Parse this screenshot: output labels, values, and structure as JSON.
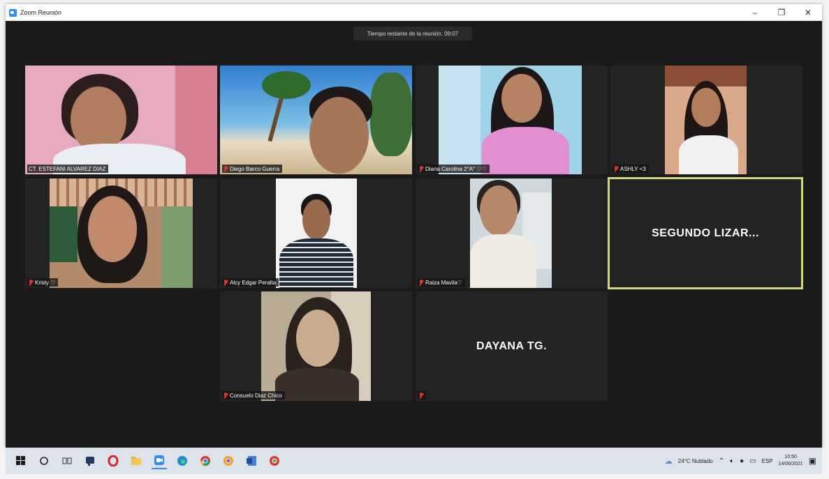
{
  "window": {
    "title": "Zoom Reunión"
  },
  "timer": {
    "text": "Tiempo restante de la reunión: 09:07"
  },
  "participants": [
    {
      "name": "CT. ESTEFANI ALVAREZ DIAZ",
      "muted": false
    },
    {
      "name": "Diego Barco Guerra",
      "muted": true
    },
    {
      "name": "Diana Carolina 2°A° ♡♡",
      "muted": true
    },
    {
      "name": "ASHLY <3",
      "muted": true
    },
    {
      "name": "Kristy ♡",
      "muted": true
    },
    {
      "name": "Alcy Edgar Peralta",
      "muted": true
    },
    {
      "name": "Raiza Mavila♡",
      "muted": true
    },
    {
      "name": "SEGUNDO  LIZAR...",
      "muted": false
    },
    {
      "name": "Consuelo Diaz Chico",
      "muted": true
    },
    {
      "name": "DAYANA TG.",
      "muted": true
    }
  ],
  "taskbar": {
    "weather": "24°C  Nublado",
    "language": "ESP",
    "time": "10:50",
    "date": "14/06/2021"
  },
  "colors": {
    "active_speaker_border": "#d3d77a",
    "mute_red": "#e0322c",
    "zoom_blue": "#2d8cff"
  }
}
